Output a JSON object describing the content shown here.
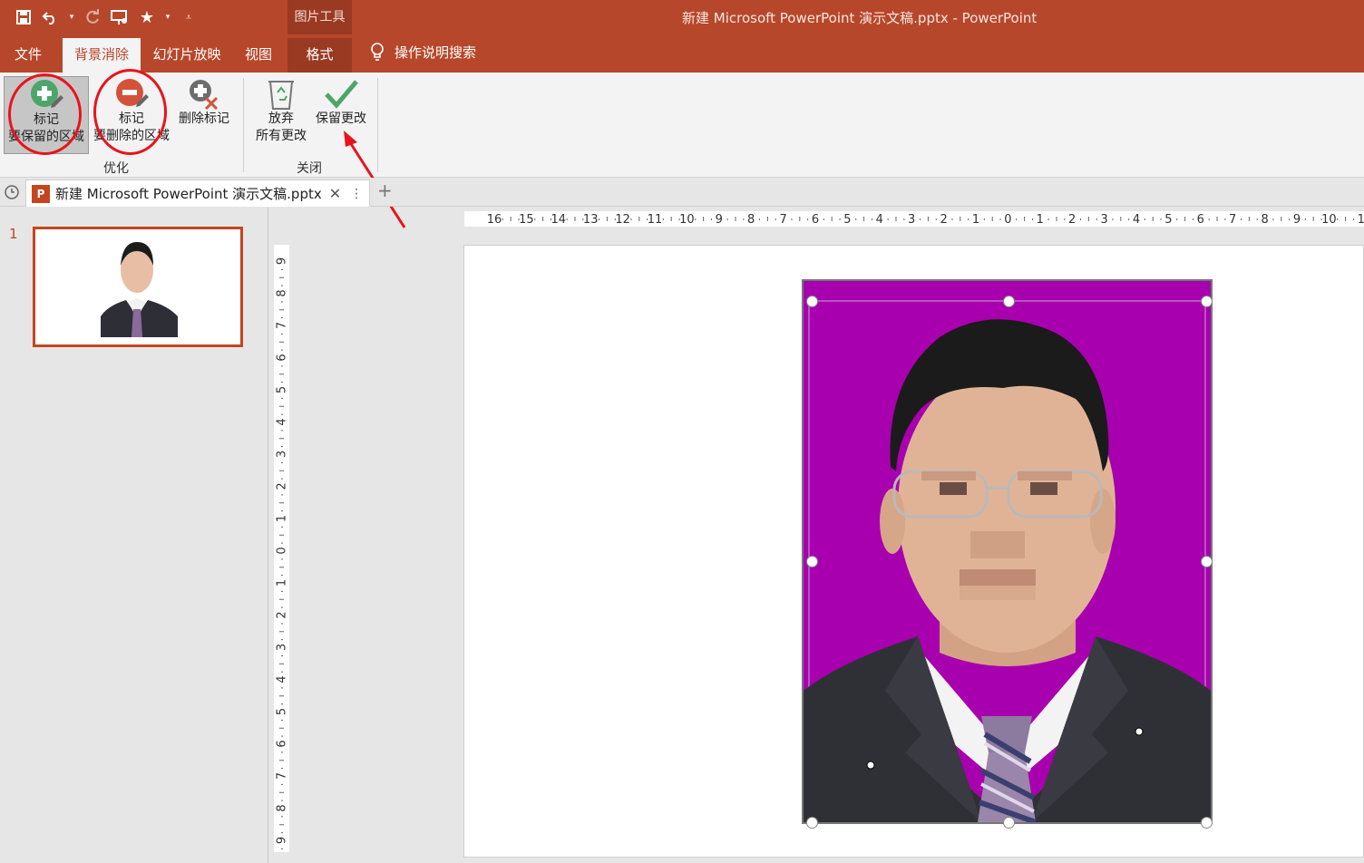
{
  "titlebar": {
    "context_tool_label": "图片工具",
    "document_title": "新建 Microsoft PowerPoint 演示文稿.pptx  -  PowerPoint",
    "qat_icons": [
      "save-icon",
      "undo-icon",
      "redo-icon",
      "presentation-icon",
      "star-icon",
      "customize-icon"
    ]
  },
  "tabs": {
    "file": "文件",
    "background_removal": "背景消除",
    "slideshow": "幻灯片放映",
    "view": "视图",
    "format": "格式",
    "search": "操作说明搜索"
  },
  "ribbon": {
    "mark_keep": {
      "line1": "标记",
      "line2": "要保留的区域"
    },
    "mark_remove": {
      "line1": "标记",
      "line2": "要删除的区域"
    },
    "delete_mark": {
      "line1": "删除标记"
    },
    "discard": {
      "line1": "放弃",
      "line2": "所有更改"
    },
    "keep_changes": {
      "line1": "保留更改"
    },
    "group_refine": "优化",
    "group_close": "关闭"
  },
  "document_tab": {
    "filename": "新建 Microsoft PowerPoint 演示文稿.pptx"
  },
  "thumbnails": {
    "slide_number": "1"
  },
  "rulers": {
    "horizontal_ticks": [
      "16",
      "15",
      "14",
      "13",
      "12",
      "11",
      "10",
      "9",
      "8",
      "7",
      "6",
      "5",
      "4",
      "3",
      "2",
      "1",
      "0",
      "1",
      "2",
      "3",
      "4",
      "5",
      "6",
      "7",
      "8",
      "9",
      "10",
      "1"
    ],
    "vertical_ticks": [
      "9",
      "8",
      "7",
      "6",
      "5",
      "4",
      "3",
      "2",
      "1",
      "0",
      "1",
      "2",
      "3",
      "4",
      "5",
      "6",
      "7",
      "8",
      "9"
    ]
  },
  "colors": {
    "accent": "#b7472a",
    "removed_area": "#a800ae",
    "annotation": "#e8141b"
  }
}
